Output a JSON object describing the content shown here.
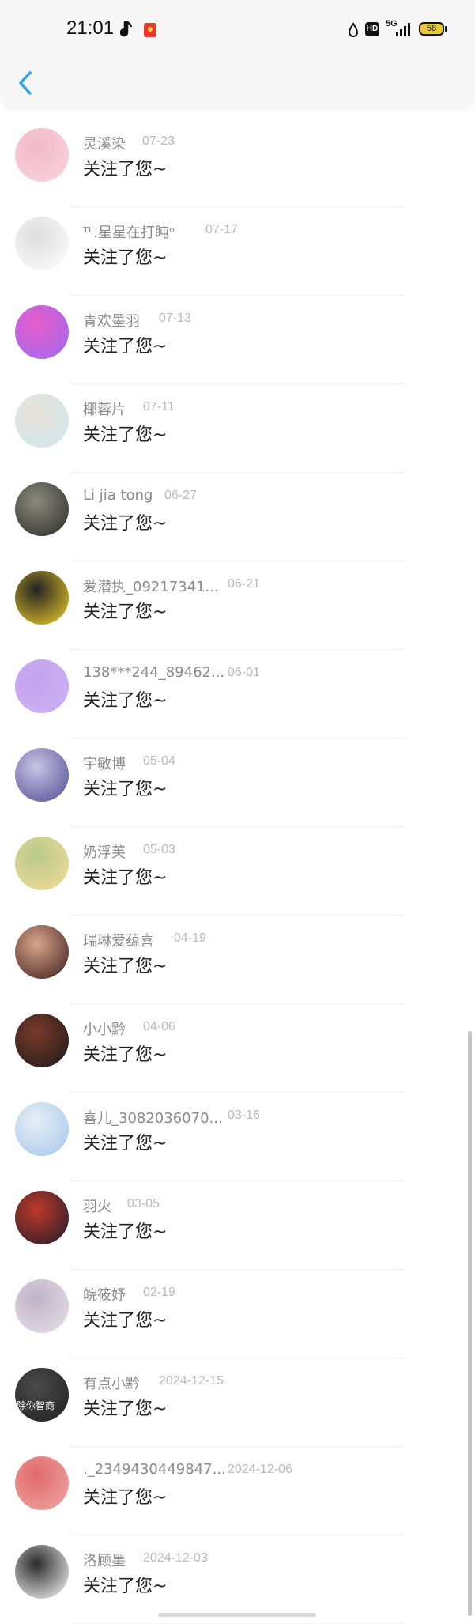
{
  "status": {
    "time": "21:01",
    "hd": "HD",
    "network": "5G",
    "battery": "58",
    "colors": {
      "battery": "#e9c93b"
    }
  },
  "header": {
    "back_icon": "chevron-left-icon",
    "accent": "#2f9fe8"
  },
  "items": [
    {
      "name": "灵溪染",
      "date": "07-23",
      "message": "关注了您~",
      "avatar": [
        "#f7d7df",
        "#f3b7c6"
      ]
    },
    {
      "name": "ᵀᴸ.星星在打盹ᵒ",
      "date": "07-17",
      "message": "关注了您~",
      "avatar": [
        "#ffffff",
        "#dddddd"
      ]
    },
    {
      "name": "青欢墨羽",
      "date": "07-13",
      "message": "关注了您~",
      "avatar": [
        "#9b6bf0",
        "#e85ccb"
      ]
    },
    {
      "name": "椰蓉片",
      "date": "07-11",
      "message": "关注了您~",
      "avatar": [
        "#cfe8f2",
        "#e8e2d6"
      ]
    },
    {
      "name": "Li jia tong",
      "date": "06-27",
      "message": "关注了您~",
      "avatar": [
        "#2b2b2b",
        "#8a8a7a"
      ]
    },
    {
      "name": "爱潜执_09217341...",
      "date": "06-21",
      "message": "关注了您~",
      "avatar": [
        "#f3d02a",
        "#222222"
      ]
    },
    {
      "name": "138***244_89462...",
      "date": "06-01",
      "message": "关注了您~",
      "avatar": [
        "#cdb2f2",
        "#c3a2f0"
      ]
    },
    {
      "name": "宇敏博",
      "date": "05-04",
      "message": "关注了您~",
      "avatar": [
        "#4e4b8f",
        "#c9c4e6"
      ]
    },
    {
      "name": "奶浮芙",
      "date": "05-03",
      "message": "关注了您~",
      "avatar": [
        "#f2dc9a",
        "#b9c98a"
      ]
    },
    {
      "name": "瑞琳爱蕴喜",
      "date": "04-19",
      "message": "关注了您~",
      "avatar": [
        "#3a1c1c",
        "#d9a58a"
      ]
    },
    {
      "name": "小小黔",
      "date": "04-06",
      "message": "关注了您~",
      "avatar": [
        "#1a1a1a",
        "#7a3a2a"
      ]
    },
    {
      "name": "喜儿_3082036070...",
      "date": "03-16",
      "message": "关注了您~",
      "avatar": [
        "#a6c7ea",
        "#e6eef7"
      ]
    },
    {
      "name": "羽火",
      "date": "03-05",
      "message": "关注了您~",
      "avatar": [
        "#1c1c2a",
        "#c0392b"
      ]
    },
    {
      "name": "皖筱妤",
      "date": "02-19",
      "message": "关注了您~",
      "avatar": [
        "#e7e0ea",
        "#bfb3c6"
      ]
    },
    {
      "name": "有点小黔",
      "date": "2024-12-15",
      "message": "关注了您~",
      "avatar": [
        "#202020",
        "#4a4a4a"
      ],
      "overlay": "除你智商"
    },
    {
      "name": "._2349430449847...",
      "date": "2024-12-06",
      "message": "关注了您~",
      "avatar": [
        "#f0a8a8",
        "#e06a6a"
      ]
    },
    {
      "name": "洛顾墨",
      "date": "2024-12-03",
      "message": "关注了您~",
      "avatar": [
        "#ffffff",
        "#2a2a2a"
      ]
    }
  ]
}
